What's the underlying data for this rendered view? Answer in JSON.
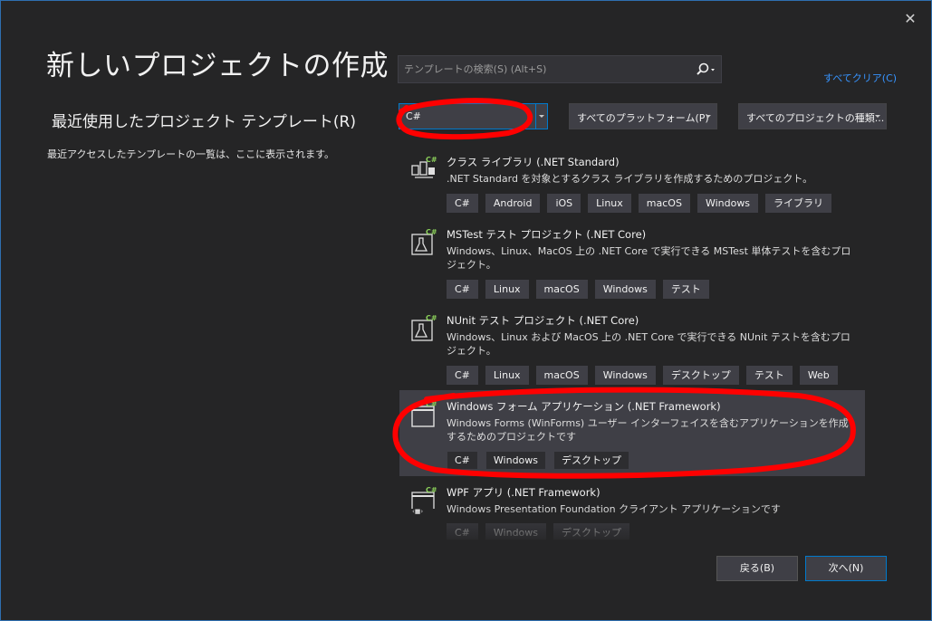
{
  "window": {
    "close_symbol": "✕",
    "page_title": "新しいプロジェクトの作成",
    "recent_title": "最近使用したプロジェクト テンプレート(R)",
    "recent_desc": "最近アクセスしたテンプレートの一覧は、ここに表示されます。"
  },
  "search": {
    "placeholder": "テンプレートの検索(S) (Alt+S)",
    "icon": "search-icon"
  },
  "clear_all": "すべてクリア(C)",
  "filters": {
    "language": "C#",
    "platform": "すべてのプラットフォーム(P)",
    "project_type": "すべてのプロジェクトの種類..."
  },
  "templates": [
    {
      "name": "クラス ライブラリ (.NET Standard)",
      "desc": ".NET Standard を対象とするクラス ライブラリを作成するためのプロジェクト。",
      "tags": [
        "C#",
        "Android",
        "iOS",
        "Linux",
        "macOS",
        "Windows",
        "ライブラリ"
      ]
    },
    {
      "name": "MSTest テスト プロジェクト (.NET Core)",
      "desc": "Windows、Linux、MacOS 上の .NET Core で実行できる MSTest 単体テストを含むプロジェクト。",
      "tags": [
        "C#",
        "Linux",
        "macOS",
        "Windows",
        "テスト"
      ]
    },
    {
      "name": "NUnit テスト プロジェクト (.NET Core)",
      "desc": "Windows、Linux および MacOS 上の .NET Core で実行できる NUnit テストを含むプロジェクト。",
      "tags": [
        "C#",
        "Linux",
        "macOS",
        "Windows",
        "デスクトップ",
        "テスト",
        "Web"
      ]
    },
    {
      "name": "Windows フォーム アプリケーション (.NET Framework)",
      "desc": "Windows Forms (WinForms) ユーザー インターフェイスを含むアプリケーションを作成するためのプロジェクトです",
      "tags": [
        "C#",
        "Windows",
        "デスクトップ"
      ]
    },
    {
      "name": "WPF アプリ (.NET Framework)",
      "desc": "Windows Presentation Foundation クライアント アプリケーションです",
      "tags": [
        "C#",
        "Windows",
        "デスクトップ"
      ]
    }
  ],
  "buttons": {
    "back": "戻る(B)",
    "next": "次へ(N)"
  },
  "colors": {
    "accent": "#007acc",
    "link": "#3794ff",
    "annotation": "#ff0000"
  }
}
